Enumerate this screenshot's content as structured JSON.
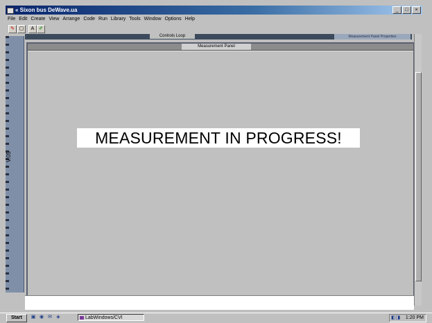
{
  "window": {
    "title": "« Sixon bus DeWave.ua",
    "menu": [
      "File",
      "Edit",
      "Create",
      "View",
      "Arrange",
      "Code",
      "Run",
      "Library",
      "Tools",
      "Window",
      "Options",
      "Help"
    ],
    "toolbar_icons": [
      "operate-tool-icon",
      "select-tool-icon",
      "text-tool-icon",
      "color-tool-icon"
    ],
    "controls": [
      "minimize-icon",
      "maximize-icon",
      "close-icon"
    ]
  },
  "workspace": {
    "top_label": "Controls Loop",
    "top_right_label": "Measurement Panel Properties",
    "side_label": "V.05"
  },
  "panel": {
    "title": "Measurement Panel",
    "message": "MEASUREMENT IN PROGRESS!"
  },
  "taskbar": {
    "start_label": "Start",
    "task_button_label": "LabWindows/CVI",
    "clock": "1:20 PM"
  },
  "colors": {
    "titlebar": "#08246b",
    "panel_background": "#c0c0c0",
    "message_background": "#ffffff"
  }
}
